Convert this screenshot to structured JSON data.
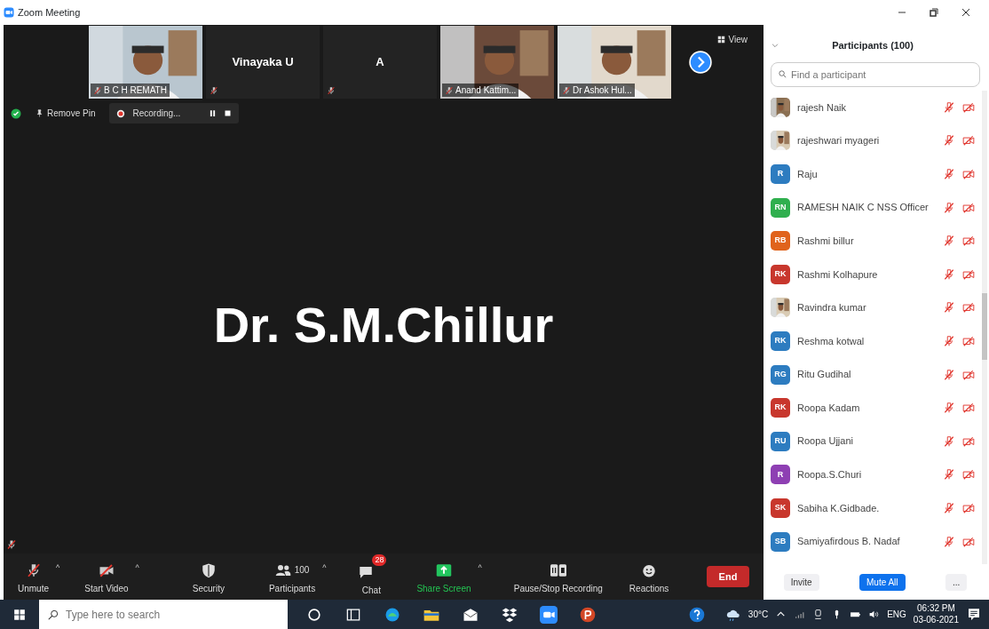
{
  "window": {
    "title": "Zoom Meeting"
  },
  "thumbnails": [
    {
      "name": "B C H REMATH",
      "kind": "video",
      "muted": true
    },
    {
      "name": "Vinayaka U",
      "kind": "name",
      "muted": true
    },
    {
      "name": "A",
      "kind": "name",
      "muted": true
    },
    {
      "name": "Anand Kattim...",
      "kind": "video",
      "muted": true
    },
    {
      "name": "Dr Ashok Hul...",
      "kind": "video",
      "muted": true
    }
  ],
  "view_button": "View",
  "pin_button": "Remove Pin",
  "recording": {
    "label": "Recording..."
  },
  "speaker": {
    "name": "Dr. S.M.Chillur",
    "muted": true
  },
  "toolbar": [
    {
      "kind": "mic",
      "label": "Unmute",
      "caret": "^"
    },
    {
      "kind": "video",
      "label": "Start Video",
      "caret": "^"
    },
    {
      "kind": "security",
      "label": "Security"
    },
    {
      "kind": "participants",
      "label": "Participants",
      "count": "100",
      "caret": "^"
    },
    {
      "kind": "chat",
      "label": "Chat",
      "badge": "28"
    },
    {
      "kind": "share",
      "label": "Share Screen",
      "caret": "^"
    },
    {
      "kind": "record",
      "label": "Pause/Stop Recording"
    },
    {
      "kind": "reactions",
      "label": "Reactions"
    }
  ],
  "end_button": "End",
  "participants_panel": {
    "title": "Participants (100)",
    "search": {
      "placeholder": "Find a participant"
    },
    "items": [
      {
        "name": "rajesh Naik",
        "muted": true,
        "video_off": true
      },
      {
        "name": "rajeshwari myageri",
        "muted": true,
        "video_off": true
      },
      {
        "name": "Raju",
        "kind": "initials",
        "initials": "R",
        "color": "#2d7cc0",
        "muted": true,
        "video_off": true
      },
      {
        "name": "RAMESH NAIK C NSS Officer",
        "kind": "initials",
        "initials": "RN",
        "color": "#2faf4e",
        "muted": true,
        "video_off": true
      },
      {
        "name": "Rashmi billur",
        "kind": "initials",
        "initials": "RB",
        "color": "#e0631c",
        "muted": true,
        "video_off": true
      },
      {
        "name": "Rashmi Kolhapure",
        "kind": "initials",
        "initials": "RK",
        "color": "#c8372d",
        "muted": true,
        "video_off": true
      },
      {
        "name": "Ravindra kumar",
        "muted": true,
        "video_off": true
      },
      {
        "name": "Reshma kotwal",
        "kind": "initials",
        "initials": "RK",
        "color": "#2d7cc0",
        "muted": true,
        "video_off": true
      },
      {
        "name": "Ritu Gudihal",
        "kind": "initials",
        "initials": "RG",
        "color": "#2d7cc0",
        "muted": true,
        "video_off": true
      },
      {
        "name": "Roopa Kadam",
        "kind": "initials",
        "initials": "RK",
        "color": "#c8372d",
        "muted": true,
        "video_off": true
      },
      {
        "name": "Roopa Ujjani",
        "kind": "initials",
        "initials": "RU",
        "color": "#2d7cc0",
        "muted": true,
        "video_off": true
      },
      {
        "name": "Roopa.S.Churi",
        "kind": "initials",
        "initials": "R",
        "color": "#8e3fb3",
        "muted": true,
        "video_off": true
      },
      {
        "name": "Sabiha  K.Gidbade.",
        "kind": "initials",
        "initials": "SK",
        "color": "#c8372d",
        "muted": true,
        "video_off": true
      },
      {
        "name": "Samiyafirdous B. Nadaf",
        "kind": "initials",
        "initials": "SB",
        "color": "#2d7cc0",
        "muted": true,
        "video_off": true
      }
    ],
    "buttons": [
      {
        "label": "Invite",
        "kind": "plain"
      },
      {
        "label": "Mute All",
        "kind": "primary"
      },
      {
        "label": "...",
        "kind": "plain"
      }
    ]
  },
  "taskbar": {
    "search": {
      "placeholder": "Type here to search"
    },
    "weather": "30°C",
    "language": "ENG",
    "time": "06:32 PM",
    "date": "03-06-2021"
  }
}
